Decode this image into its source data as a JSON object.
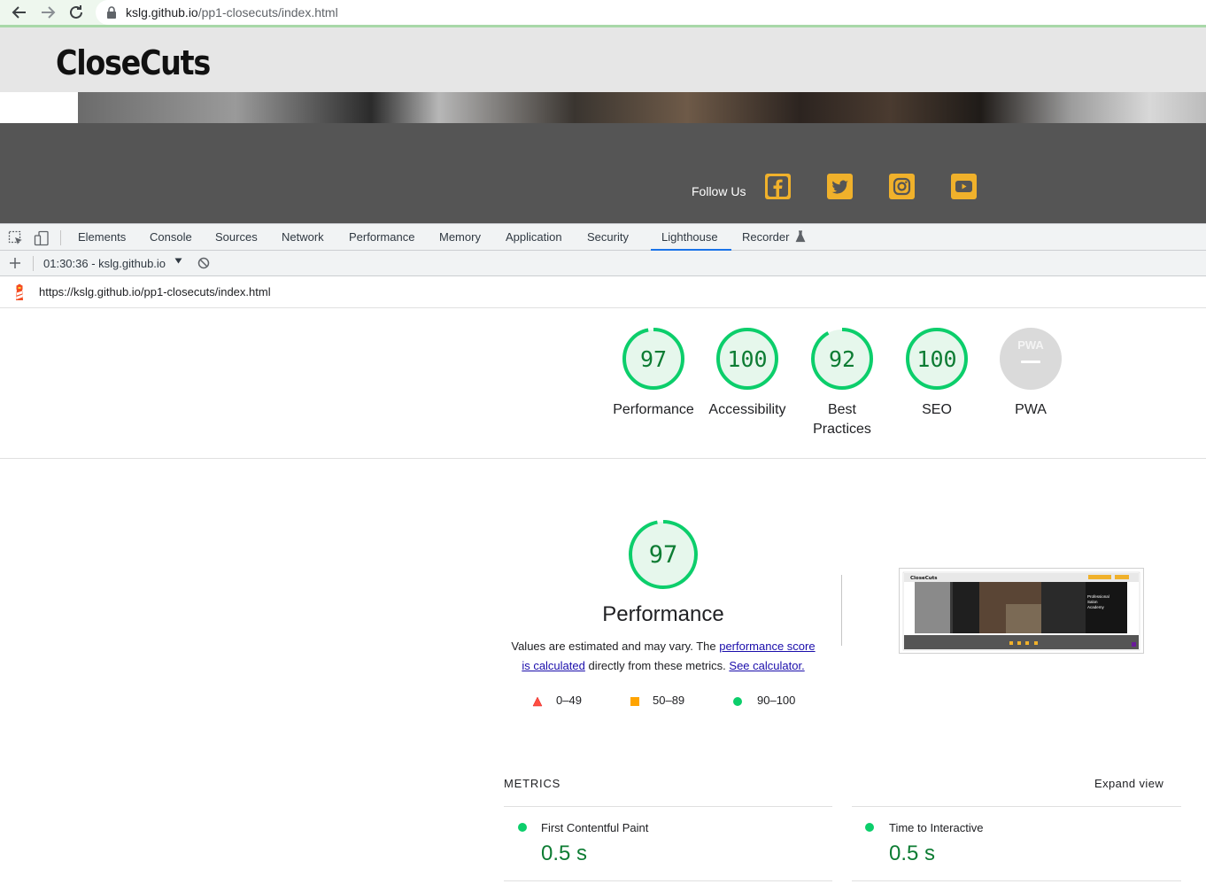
{
  "browser": {
    "url_host": "kslg.github.io",
    "url_path": "/pp1-closecuts/index.html"
  },
  "site": {
    "logo": "CloseCuts",
    "follow_label": "Follow Us",
    "social": [
      "facebook-icon",
      "twitter-icon",
      "instagram-icon",
      "youtube-icon"
    ],
    "accent_color": "#f0b12b",
    "footer_color": "#555555"
  },
  "devtools": {
    "tabs": [
      "Elements",
      "Console",
      "Sources",
      "Network",
      "Performance",
      "Memory",
      "Application",
      "Security",
      "Lighthouse",
      "Recorder"
    ],
    "active_tab": "Lighthouse",
    "report_selector": "01:30:36 - kslg.github.io",
    "report_url": "https://kslg.github.io/pp1-closecuts/index.html"
  },
  "scores": [
    {
      "label": "Performance",
      "score": "97",
      "value": 97
    },
    {
      "label": "Accessibility",
      "score": "100",
      "value": 100
    },
    {
      "label_line1": "Best",
      "label_line2": "Practices",
      "score": "92",
      "value": 92
    },
    {
      "label": "SEO",
      "score": "100",
      "value": 100
    },
    {
      "label": "PWA",
      "badge": "PWA",
      "score": "—"
    }
  ],
  "performance": {
    "score": "97",
    "title": "Performance",
    "desc_prefix": "Values are estimated and may vary. The ",
    "desc_link1_a": "performance score",
    "desc_link1_b": "is calculated",
    "desc_mid": " directly from these metrics. ",
    "desc_link2": "See calculator.",
    "thumbnail": {
      "logo": "CloseCuts",
      "hero_text_1": "Professional",
      "hero_text_2": "Salon",
      "hero_text_3": "Academy"
    },
    "legend": [
      "0–49",
      "50–89",
      "90–100"
    ]
  },
  "metrics": {
    "heading": "METRICS",
    "expand_label": "Expand view",
    "items": [
      {
        "name": "First Contentful Paint",
        "value": "0.5 s"
      },
      {
        "name": "Time to Interactive",
        "value": "0.5 s"
      }
    ]
  },
  "colors": {
    "pass": "#0cce6b",
    "pass_text": "#0d7c33",
    "average": "#ffa400",
    "fail": "#ff4e42",
    "active_tab": "#1a73e8"
  }
}
